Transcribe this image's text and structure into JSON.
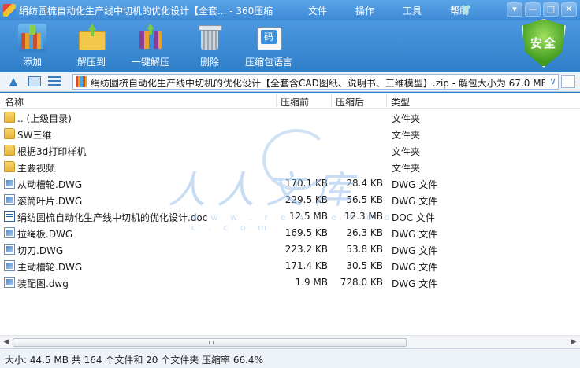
{
  "window": {
    "title": "绢纺圆梳自动化生产线中切机的优化设计【全套... - 360压缩",
    "menu": [
      "文件",
      "操作",
      "工具",
      "帮助"
    ],
    "controls": [
      "▾",
      "—",
      "□",
      "✕"
    ]
  },
  "toolbar": {
    "buttons": [
      {
        "label": "添加",
        "icon": "add-archive-icon"
      },
      {
        "label": "解压到",
        "icon": "extract-folder-icon"
      },
      {
        "label": "一键解压",
        "icon": "one-click-extract-icon"
      },
      {
        "label": "删除",
        "icon": "trash-icon"
      },
      {
        "label": "压缩包语言",
        "icon": "encoding-icon"
      }
    ],
    "security_badge": "安全"
  },
  "address": {
    "path": "绢纺圆梳自动化生产线中切机的优化设计【全套含CAD图纸、说明书、三维模型】.zip - 解包大小为 67.0 MB",
    "dropdown": "∨"
  },
  "columns": {
    "name": "名称",
    "packed": "压缩前",
    "size": "压缩后",
    "type": "类型"
  },
  "files": [
    {
      "name": ".. (上级目录)",
      "packed": "",
      "size": "",
      "type": "文件夹",
      "icon": "folder"
    },
    {
      "name": "SW三维",
      "packed": "",
      "size": "",
      "type": "文件夹",
      "icon": "folder"
    },
    {
      "name": "根据3d打印样机",
      "packed": "",
      "size": "",
      "type": "文件夹",
      "icon": "folder"
    },
    {
      "name": "主要视频",
      "packed": "",
      "size": "",
      "type": "文件夹",
      "icon": "folder"
    },
    {
      "name": "从动槽轮.DWG",
      "packed": "170.1 KB",
      "size": "28.4 KB",
      "type": "DWG 文件",
      "icon": "dwg"
    },
    {
      "name": "滚筒叶片.DWG",
      "packed": "229.5 KB",
      "size": "56.5 KB",
      "type": "DWG 文件",
      "icon": "dwg"
    },
    {
      "name": "绢纺圆梳自动化生产线中切机的优化设计.doc",
      "packed": "12.5 MB",
      "size": "12.3 MB",
      "type": "DOC 文件",
      "icon": "doc"
    },
    {
      "name": "拉绳板.DWG",
      "packed": "169.5 KB",
      "size": "26.3 KB",
      "type": "DWG 文件",
      "icon": "dwg"
    },
    {
      "name": "切刀.DWG",
      "packed": "223.2 KB",
      "size": "53.8 KB",
      "type": "DWG 文件",
      "icon": "dwg"
    },
    {
      "name": "主动槽轮.DWG",
      "packed": "171.4 KB",
      "size": "30.5 KB",
      "type": "DWG 文件",
      "icon": "dwg"
    },
    {
      "name": "装配图.dwg",
      "packed": "1.9 MB",
      "size": "728.0 KB",
      "type": "DWG 文件",
      "icon": "dwg"
    }
  ],
  "watermark": {
    "text": "人人文库",
    "url": "w w w . r e n r e n d o c . c o m"
  },
  "status": "大小: 44.5 MB 共 164 个文件和 20 个文件夹 压缩率 66.4%"
}
